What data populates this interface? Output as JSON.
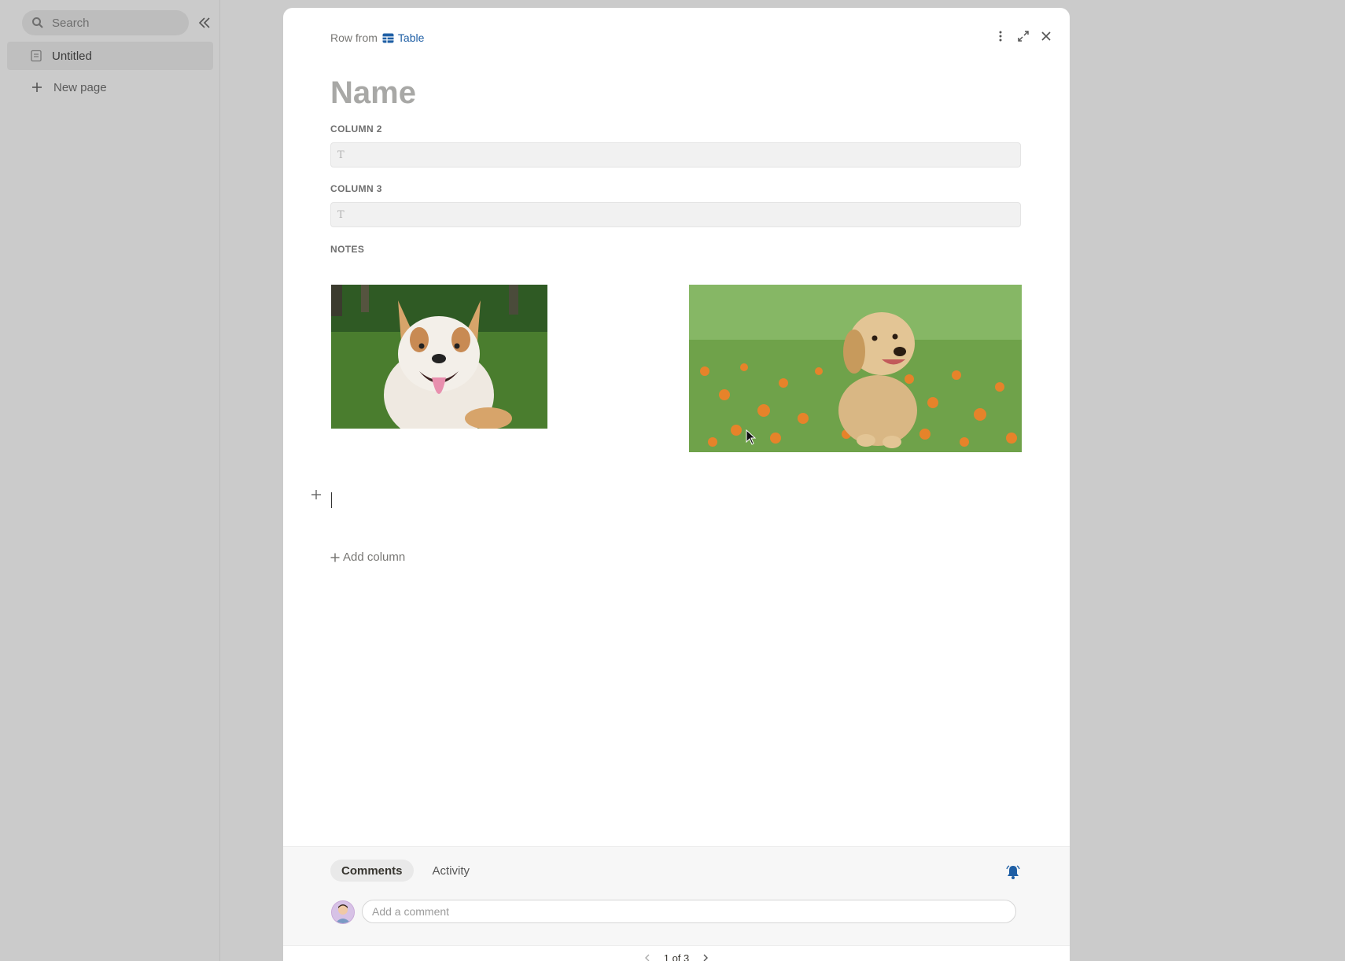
{
  "sidebar": {
    "search_placeholder": "Search",
    "items": [
      {
        "label": "Untitled",
        "icon": "page-icon"
      }
    ],
    "new_page_label": "New page"
  },
  "modal": {
    "breadcrumb_prefix": "Row from",
    "breadcrumb_table": "Table",
    "title_placeholder": "Name",
    "fields": [
      {
        "label": "COLUMN 2",
        "type_icon": "T"
      },
      {
        "label": "COLUMN 3",
        "type_icon": "T"
      },
      {
        "label": "NOTES"
      }
    ],
    "images": [
      {
        "alt": "Smiling white and tan dog on grass"
      },
      {
        "alt": "Golden retriever puppy sitting in orange flowers"
      }
    ],
    "add_column_label": "Add column"
  },
  "footer": {
    "tabs": [
      {
        "label": "Comments",
        "active": true
      },
      {
        "label": "Activity",
        "active": false
      }
    ],
    "comment_placeholder": "Add a comment",
    "pager": "1 of 3"
  },
  "colors": {
    "accent": "#1f5fa5",
    "bell": "#1f5fa5"
  }
}
